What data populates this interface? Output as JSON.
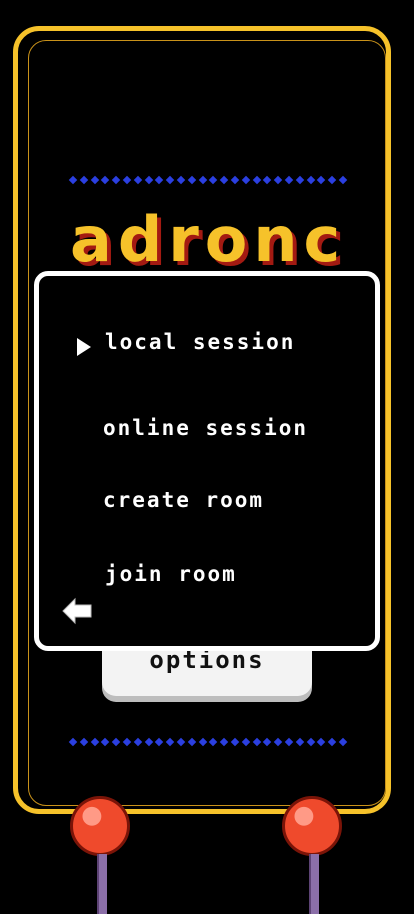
{
  "game": {
    "title": "adronc",
    "menu": {
      "items": [
        "local session",
        "online session",
        "create room",
        "join room"
      ],
      "selected_index": 0
    },
    "options_label": "options",
    "colors": {
      "frame": "#f6c22a",
      "title_shadow": "#a31a12",
      "dots": "#2b3fe0",
      "panel_border": "#ffffff",
      "joystick_ball": "#ef4a2c"
    },
    "icons": {
      "back": "back-arrow-icon",
      "selector": "triangle-pointer-icon",
      "joystick": "joystick-icon"
    }
  }
}
